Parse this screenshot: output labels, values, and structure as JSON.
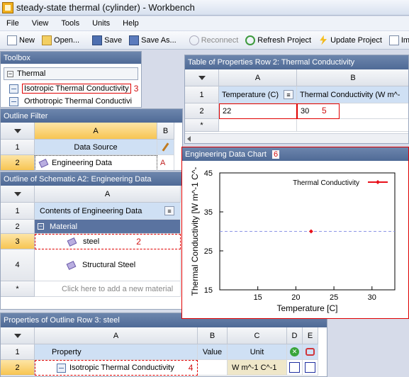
{
  "window": {
    "title": "steady-state thermal (cylinder) - Workbench"
  },
  "menu": [
    "File",
    "View",
    "Tools",
    "Units",
    "Help"
  ],
  "toolbar": {
    "new": "New",
    "open": "Open...",
    "save": "Save",
    "save_as": "Save As...",
    "reconnect": "Reconnect",
    "refresh": "Refresh Project",
    "update": "Update Project",
    "cut_off": "Im"
  },
  "toolbox": {
    "title": "Toolbox",
    "group": "Thermal",
    "items": [
      "Isotropic Thermal Conductivity",
      "Orthotropic Thermal Conductivi"
    ],
    "annotation": "3"
  },
  "outline_filter": {
    "title": "Outline Filter",
    "col_a": "A",
    "col_b": "B",
    "row1_num": "1",
    "row1_header": "Data Source",
    "row2_num": "2",
    "row2_value": "Engineering Data",
    "row2_b": "A"
  },
  "outline_schematic": {
    "title": "Outline of Schematic A2: Engineering Data",
    "col_a": "A",
    "rows": [
      {
        "num": "1",
        "text": "Contents of Engineering Data"
      },
      {
        "num": "2",
        "text": "Material"
      },
      {
        "num": "3",
        "text": "steel"
      },
      {
        "num": "4",
        "text": "Structural Steel"
      },
      {
        "num": "*",
        "text": "Click here to add a new material"
      }
    ],
    "annotation": "2"
  },
  "properties_outline": {
    "title": "Properties of Outline Row 3: steel",
    "cols": [
      "A",
      "B",
      "C",
      "D",
      "E"
    ],
    "header": {
      "num": "1",
      "property": "Property",
      "value": "Value",
      "unit": "Unit"
    },
    "row2": {
      "num": "2",
      "property": "Isotropic Thermal Conductivity",
      "unit": "W m^-1 C^-1"
    },
    "annotation": "4"
  },
  "table_properties": {
    "title": "Table of Properties Row 2: Thermal Conductivity",
    "col_a": "A",
    "col_b": "B",
    "row1": {
      "num": "1",
      "a": "Temperature (C)",
      "b": "Thermal Conductivity (W m^-"
    },
    "row2": {
      "num": "2",
      "a": "22",
      "b": "30"
    },
    "row_new": "*",
    "annotation": "5"
  },
  "chart_panel": {
    "title": "Engineering Data Chart",
    "annotation": "6"
  },
  "chart_data": {
    "type": "scatter",
    "title": "",
    "xlabel": "Temperature  [C]",
    "ylabel": "Thermal Conductivity  [W m^-1 C^-",
    "xlim": [
      10,
      33
    ],
    "ylim": [
      15,
      45
    ],
    "xticks": [
      15,
      20,
      25,
      30
    ],
    "yticks": [
      15,
      25,
      35,
      45
    ],
    "ytick_labels": [
      "15",
      "25",
      "35",
      "45"
    ],
    "grid": false,
    "legend_position": "top-right",
    "series": [
      {
        "name": "Thermal Conductivity",
        "color": "#e8101a",
        "points": [
          {
            "x": 22,
            "y": 30
          }
        ]
      }
    ],
    "reference_line": {
      "y": 30,
      "color": "#8c96e6"
    }
  },
  "colors": {
    "panel_header": "#5a73a0",
    "selection_blue": "#cfe0f4",
    "annotation_red": "#d01010"
  }
}
